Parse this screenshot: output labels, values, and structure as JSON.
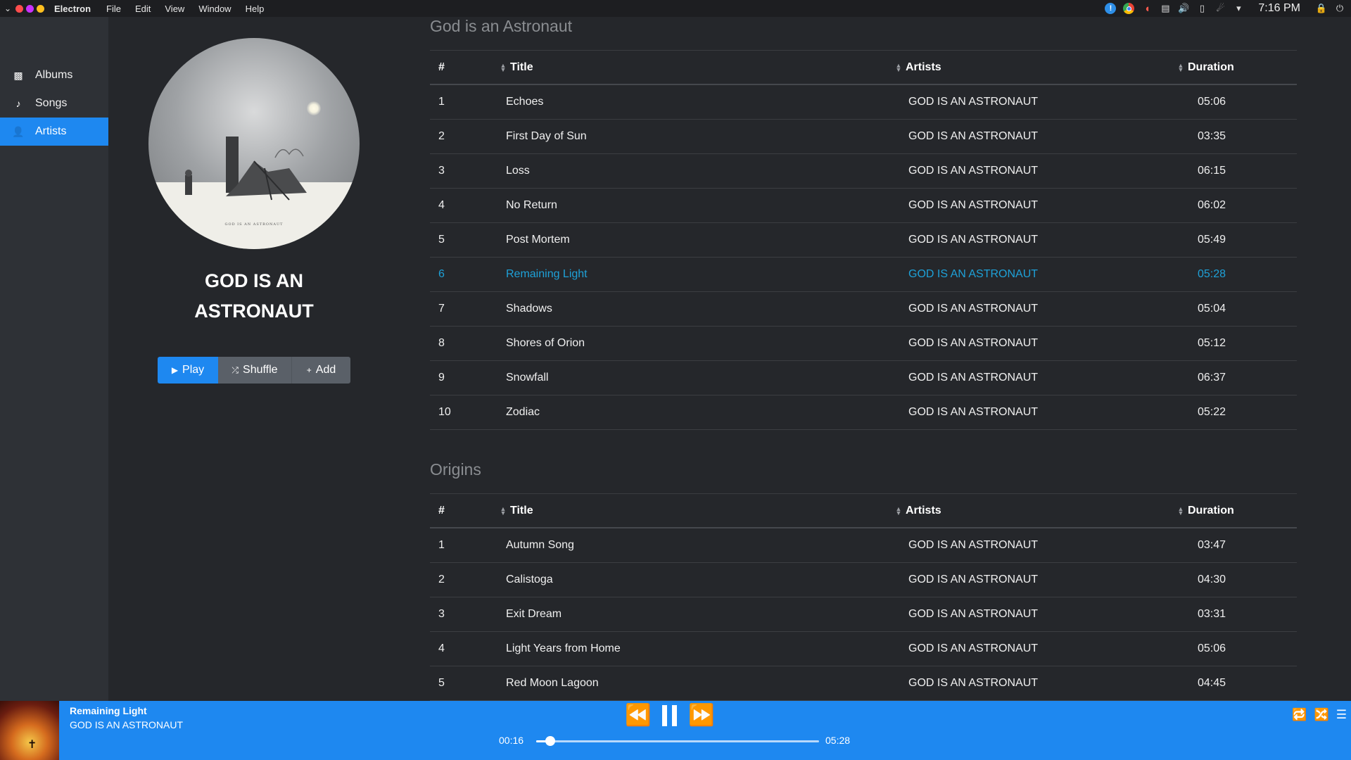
{
  "menubar": {
    "app_name": "Electron",
    "menus": [
      "File",
      "Edit",
      "View",
      "Window",
      "Help"
    ],
    "clock": "7:16 PM",
    "window_dot_colors": [
      "#ff4d4d",
      "#c931ff",
      "#ffbf1f"
    ]
  },
  "sidebar": {
    "items": [
      {
        "label": "Albums",
        "icon": "albums-icon",
        "active": false
      },
      {
        "label": "Songs",
        "icon": "music-note-icon",
        "active": false
      },
      {
        "label": "Artists",
        "icon": "person-icon",
        "active": true
      }
    ]
  },
  "artist": {
    "name_line1": "GOD IS AN",
    "name_line2": "ASTRONAUT",
    "cover_caption": "GOD IS AN ASTRONAUT",
    "buttons": {
      "play": "Play",
      "shuffle": "Shuffle",
      "add": "Add"
    }
  },
  "columns": {
    "num": "#",
    "title": "Title",
    "artists": "Artists",
    "duration": "Duration"
  },
  "albums": [
    {
      "title": "God is an Astronaut",
      "tracks": [
        {
          "num": "1",
          "title": "Echoes",
          "artist": "GOD IS AN ASTRONAUT",
          "duration": "05:06"
        },
        {
          "num": "2",
          "title": "First Day of Sun",
          "artist": "GOD IS AN ASTRONAUT",
          "duration": "03:35"
        },
        {
          "num": "3",
          "title": "Loss",
          "artist": "GOD IS AN ASTRONAUT",
          "duration": "06:15"
        },
        {
          "num": "4",
          "title": "No Return",
          "artist": "GOD IS AN ASTRONAUT",
          "duration": "06:02"
        },
        {
          "num": "5",
          "title": "Post Mortem",
          "artist": "GOD IS AN ASTRONAUT",
          "duration": "05:49"
        },
        {
          "num": "6",
          "title": "Remaining Light",
          "artist": "GOD IS AN ASTRONAUT",
          "duration": "05:28",
          "playing": true
        },
        {
          "num": "7",
          "title": "Shadows",
          "artist": "GOD IS AN ASTRONAUT",
          "duration": "05:04"
        },
        {
          "num": "8",
          "title": "Shores of Orion",
          "artist": "GOD IS AN ASTRONAUT",
          "duration": "05:12"
        },
        {
          "num": "9",
          "title": "Snowfall",
          "artist": "GOD IS AN ASTRONAUT",
          "duration": "06:37"
        },
        {
          "num": "10",
          "title": "Zodiac",
          "artist": "GOD IS AN ASTRONAUT",
          "duration": "05:22"
        }
      ]
    },
    {
      "title": "Origins",
      "tracks": [
        {
          "num": "1",
          "title": "Autumn Song",
          "artist": "GOD IS AN ASTRONAUT",
          "duration": "03:47"
        },
        {
          "num": "2",
          "title": "Calistoga",
          "artist": "GOD IS AN ASTRONAUT",
          "duration": "04:30"
        },
        {
          "num": "3",
          "title": "Exit Dream",
          "artist": "GOD IS AN ASTRONAUT",
          "duration": "03:31"
        },
        {
          "num": "4",
          "title": "Light Years from Home",
          "artist": "GOD IS AN ASTRONAUT",
          "duration": "05:06"
        },
        {
          "num": "5",
          "title": "Red Moon Lagoon",
          "artist": "GOD IS AN ASTRONAUT",
          "duration": "04:45"
        }
      ]
    }
  ],
  "player": {
    "now_title": "Remaining Light",
    "now_artist": "GOD IS AN ASTRONAUT",
    "elapsed": "00:16",
    "total": "05:28",
    "progress": 0.049,
    "accent": "#1e88f0",
    "playing_color": "#1ea1d8"
  }
}
